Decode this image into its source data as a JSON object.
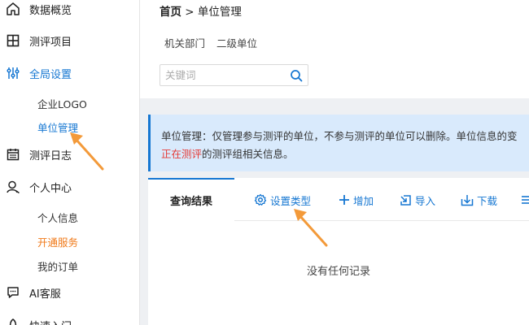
{
  "sidebar": {
    "items": [
      {
        "label": "数据概览",
        "icon": "home-icon"
      },
      {
        "label": "测评项目",
        "icon": "grid-icon"
      },
      {
        "label": "全局设置",
        "icon": "sliders-icon"
      },
      {
        "label": "测评日志",
        "icon": "calendar-icon"
      },
      {
        "label": "个人中心",
        "icon": "user-icon"
      },
      {
        "label": "AI客服",
        "icon": "chat-icon"
      },
      {
        "label": "快速入门",
        "icon": "rocket-icon"
      }
    ],
    "settings_sub": [
      "企业LOGO",
      "单位管理"
    ],
    "personal_sub": [
      "个人信息",
      "开通服务",
      "我的订单"
    ]
  },
  "header": {
    "breadcrumb_home": "首页",
    "breadcrumb_sep": ">",
    "breadcrumb_current": "单位管理"
  },
  "unit_tabs": [
    "机关部门",
    "二级单位"
  ],
  "search": {
    "placeholder": "关键词"
  },
  "notice": {
    "line1": "单位管理：仅管理参与测评的单位，不参与测评的单位可以删除。单位信息的变",
    "line2_red": "正在测评",
    "line2_rest": "的测评组相关信息。"
  },
  "results": {
    "tab_label": "查询结果",
    "toolbar": {
      "settings_label": "设置类型",
      "add_label": "增加",
      "import_label": "导入",
      "download_label": "下载"
    },
    "empty_text": "没有任何记录"
  },
  "colors": {
    "accent": "#1677d2",
    "highlight": "#f07a1a",
    "warning": "#e53935"
  }
}
